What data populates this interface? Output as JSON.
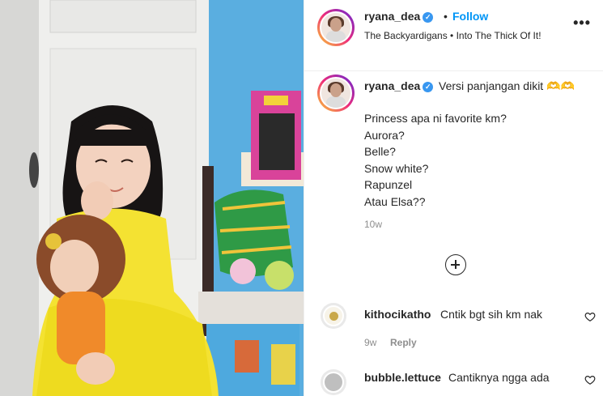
{
  "post": {
    "media_alt": "",
    "header": {
      "username": "ryana_dea",
      "separator": "•",
      "follow_label": "Follow",
      "audio": "The Backyardigans • Into The Thick Of It!",
      "more_label": "•••"
    },
    "caption": {
      "username": "ryana_dea",
      "first_line": "Versi panjangan dikit 🫶🫶",
      "lines": [
        "Princess apa ni favorite km?",
        "Aurora?",
        "Belle?",
        "Snow white?",
        "Rapunzel",
        "Atau Elsa??"
      ],
      "time": "10w"
    },
    "comments": [
      {
        "username": "kithocikatho",
        "text": "Cntik bgt sih km nak",
        "time": "9w",
        "reply_label": "Reply"
      },
      {
        "username": "bubble.lettuce",
        "text": "Cantiknya ngga ada",
        "time": "",
        "reply_label": ""
      }
    ],
    "colors": {
      "link": "#0095f6",
      "verified": "#3897f0",
      "muted": "#8e8e8e",
      "text": "#262626"
    },
    "icons": [
      "verified-badge-icon",
      "more-options-icon",
      "load-more-comments-icon",
      "heart-icon"
    ]
  }
}
